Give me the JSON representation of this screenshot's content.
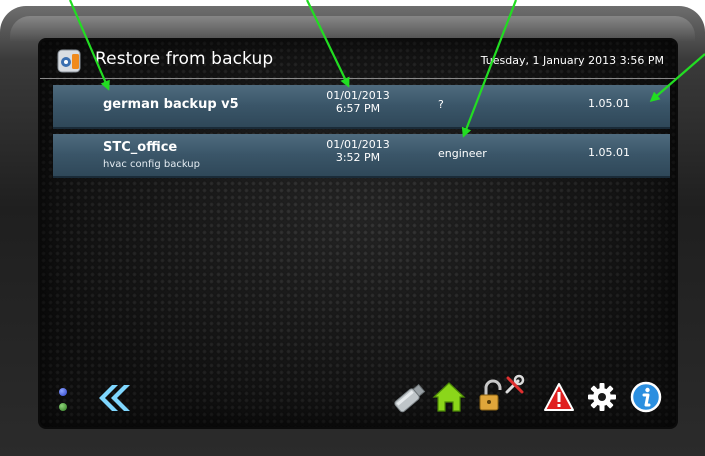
{
  "header": {
    "title": "Restore from backup",
    "datetime": "Tuesday, 1 January 2013 3:56 PM"
  },
  "backups": [
    {
      "name": "german backup v5",
      "subtitle": "",
      "date": "01/01/2013",
      "time": "6:57 PM",
      "user": "?",
      "version": "1.05.01"
    },
    {
      "name": "STC_office",
      "subtitle": "hvac config backup",
      "date": "01/01/2013",
      "time": "3:52 PM",
      "user": "engineer",
      "version": "1.05.01"
    }
  ],
  "toolbar": {
    "icons": [
      "back-icon",
      "usb-drive-icon",
      "home-icon",
      "unlock-icon",
      "tools-icon",
      "warning-icon",
      "settings-gear-icon",
      "info-icon"
    ]
  },
  "colors": {
    "row_bg": "#3a5568",
    "annotation_arrow": "#22dd22",
    "back_chevron": "#7fd7ff",
    "home": "#8bd61a",
    "warning": "#e02020",
    "info": "#2b8fe0"
  }
}
